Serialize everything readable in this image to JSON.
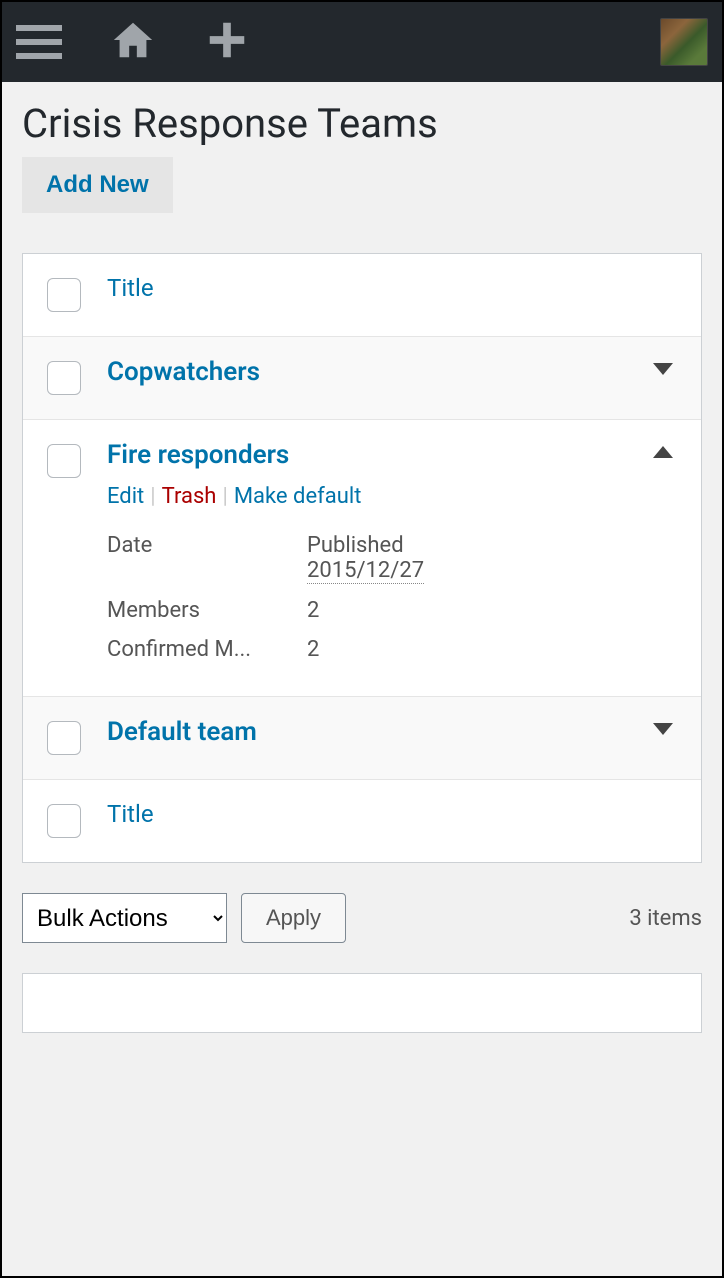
{
  "header": {
    "page_title": "Crisis Response Teams",
    "add_new_label": "Add New"
  },
  "columns": {
    "title": "Title"
  },
  "rows": [
    {
      "title": "Copwatchers",
      "expanded": false
    },
    {
      "title": "Fire responders",
      "expanded": true,
      "actions": {
        "edit": "Edit",
        "trash": "Trash",
        "make_default": "Make default"
      },
      "details": {
        "date_label": "Date",
        "date_status": "Published",
        "date_value": "2015/12/27",
        "members_label": "Members",
        "members_value": "2",
        "confirmed_label": "Confirmed M...",
        "confirmed_value": "2"
      }
    },
    {
      "title": "Default team",
      "expanded": false
    }
  ],
  "tablenav": {
    "bulk_label": "Bulk Actions",
    "apply_label": "Apply",
    "item_count": "3 items"
  }
}
